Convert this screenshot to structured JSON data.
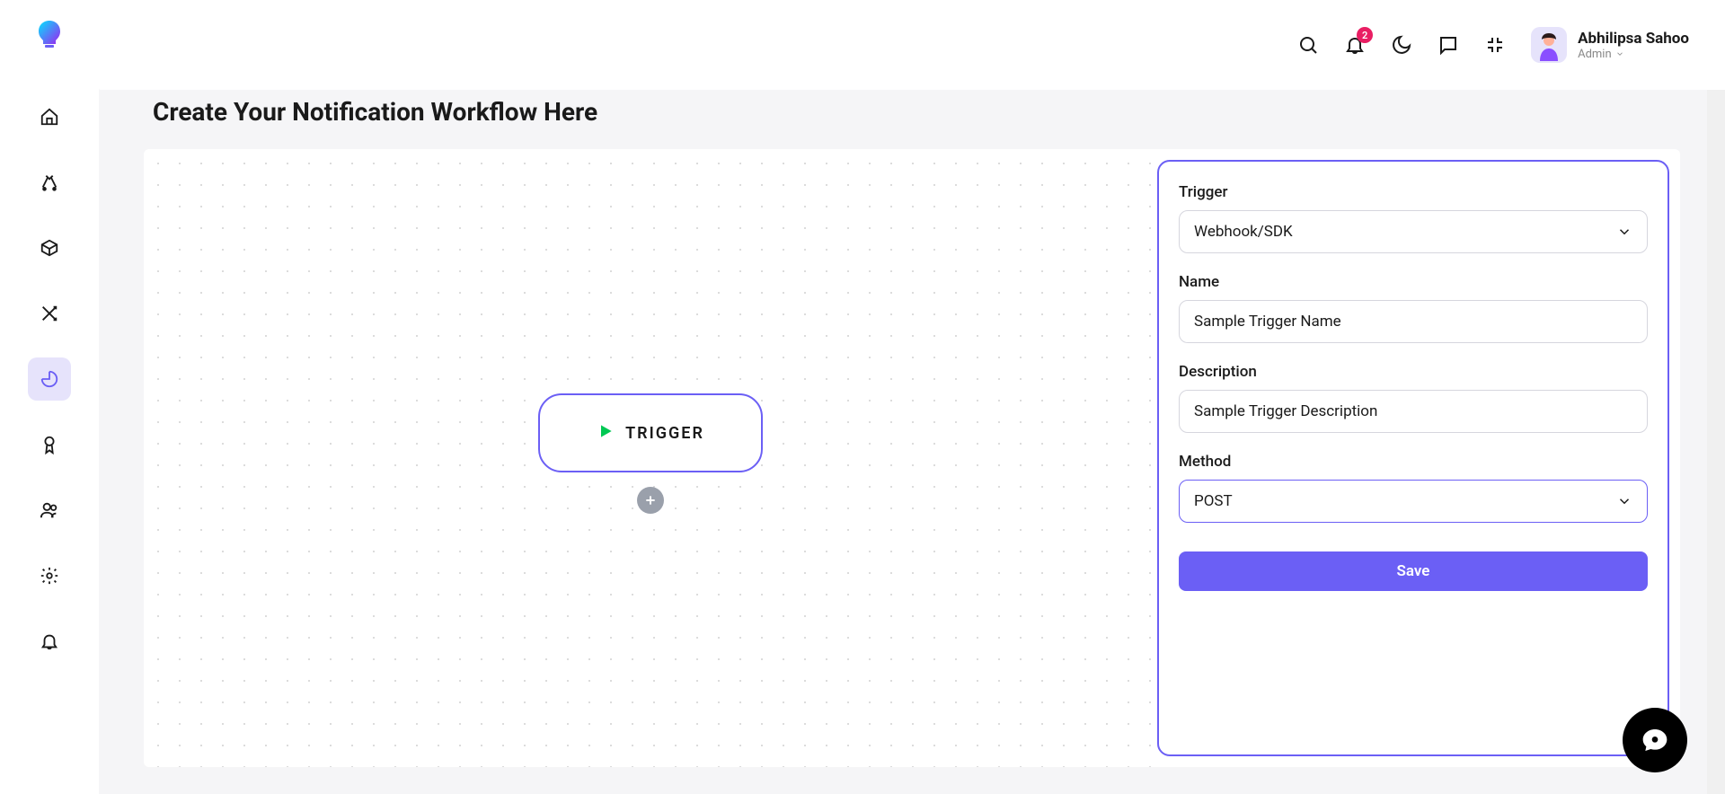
{
  "header": {
    "notification_count": "2",
    "user_name": "Abhilipsa Sahoo",
    "user_role": "Admin"
  },
  "page": {
    "title": "Create Your Notification Workflow Here"
  },
  "canvas": {
    "trigger_label": "TRIGGER"
  },
  "panel": {
    "trigger_label": "Trigger",
    "trigger_value": "Webhook/SDK",
    "name_label": "Name",
    "name_value": "Sample Trigger Name",
    "description_label": "Description",
    "description_value": "Sample Trigger Description",
    "method_label": "Method",
    "method_value": "POST",
    "save_button": "Save"
  }
}
